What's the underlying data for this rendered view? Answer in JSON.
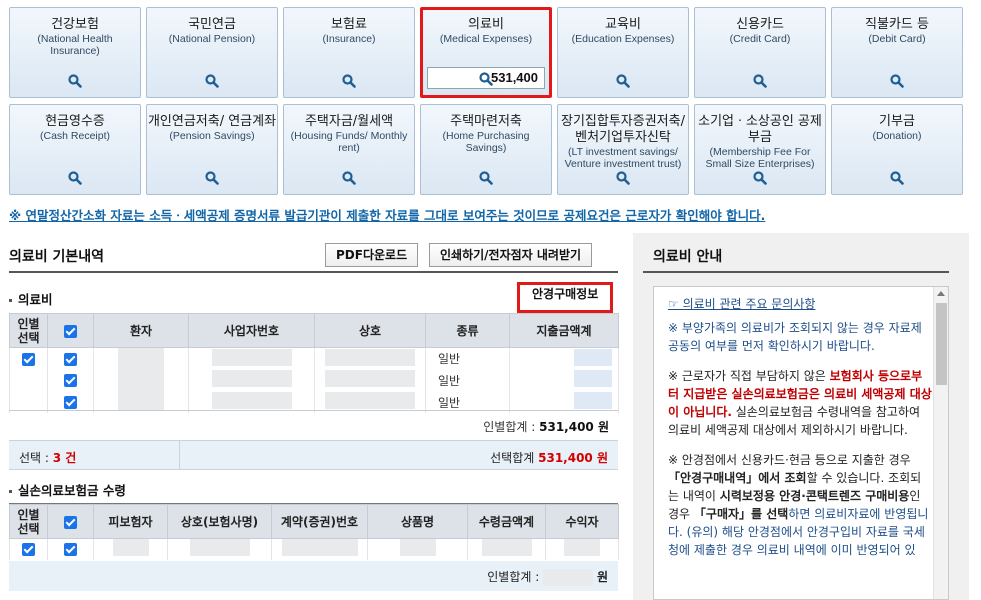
{
  "tiles": [
    {
      "title": "건강보험",
      "sub": "(National Health Insurance)"
    },
    {
      "title": "국민연금",
      "sub": "(National Pension)"
    },
    {
      "title": "보험료",
      "sub": "(Insurance)"
    },
    {
      "title": "의료비",
      "sub": "(Medical Expenses)",
      "amount": "531,400"
    },
    {
      "title": "교육비",
      "sub": "(Education Expenses)"
    },
    {
      "title": "신용카드",
      "sub": "(Credit Card)"
    },
    {
      "title": "직불카드 등",
      "sub": "(Debit Card)"
    },
    {
      "title": "현금영수증",
      "sub": "(Cash Receipt)"
    },
    {
      "title": "개인연금저축/ 연금계좌",
      "sub": "(Pension Savings)"
    },
    {
      "title": "주택자금/월세액",
      "sub": "(Housing Funds/ Monthly rent)"
    },
    {
      "title": "주택마련저축",
      "sub": "(Home Purchasing Savings)"
    },
    {
      "title": "장기집합투자증권저축/ 벤처기업투자신탁",
      "sub": "(LT investment savings/ Venture investment trust)"
    },
    {
      "title": "소기업ㆍ소상공인 공제부금",
      "sub": "(Membership Fee For Small Size Enterprises)"
    },
    {
      "title": "기부금",
      "sub": "(Donation)"
    }
  ],
  "notice": "※ 연말정산간소화 자료는 소득ㆍ세액공제 증명서류 발급기관이 제출한 자료를 그대로 보여주는 것이므로 공제요건은 근로자가 확인해야 합니다.",
  "basic": {
    "title": "의료비 기본내역",
    "pdf_button": "PDF다운로드",
    "print_button": "인쇄하기/전자점자 내려받기",
    "section_label": "의료비",
    "glasses_button": "안경구매정보",
    "headers": [
      "인별 선택",
      "",
      "환자",
      "사업자번호",
      "상호",
      "종류",
      "지출금액계"
    ],
    "rows": [
      {
        "type": "일반"
      },
      {
        "type": "일반"
      },
      {
        "type": "일반"
      }
    ],
    "person_total_label": "인별합계 :",
    "person_total_value": "531,400 원",
    "select_label": "선택 :",
    "select_count": "3 건",
    "select_total_label": "선택합계",
    "select_total_value": "531,400 원"
  },
  "insurance": {
    "section_label": "실손의료보험금 수령",
    "headers": [
      "인별 선택",
      "",
      "피보험자",
      "상호(보험사명)",
      "계약(증권)번호",
      "상품명",
      "수령금액계",
      "수익자"
    ],
    "person_total_label": "인별합계 :",
    "person_total_unit": "원"
  },
  "guide": {
    "title": "의료비 안내",
    "link": "☞ 의료비 관련 주요 문의사항",
    "p1": "※ 부양가족의 의료비가 조회되지 않는 경우 자료제공동의 여부를 먼저 확인하시기 바랍니다.",
    "p2_a": "※ 근로자가 직접 부담하지 않은 ",
    "p2_b": "보험회사 등으로부터 지급받은 실손의료보험금은 의료비 세액공제 대상이 아닙니다.",
    "p2_c": " 실손의료보험금 수령내역을 참고하여 의료비 세액공제 대상에서 제외하시기 바랍니다.",
    "p3_a": "※ 안경점에서 신용카드·현금 등으로 지출한 경우 ",
    "p3_b": "「안경구매내역」에서 조회",
    "p3_c": "할 수 있습니다. 조회되는 내역이 ",
    "p3_d": "시력보정용 안경·콘택트렌즈 구매비용",
    "p3_e": "인 경우 ",
    "p3_f": "「구매자」를 선택",
    "p3_g": "하면 의료비자료에 반영됩니다. (유의) 해당 안경점에서 안경구입비 자료를 국세청에 제출한 경우 의료비 내역에 이미 반영되어 있"
  }
}
